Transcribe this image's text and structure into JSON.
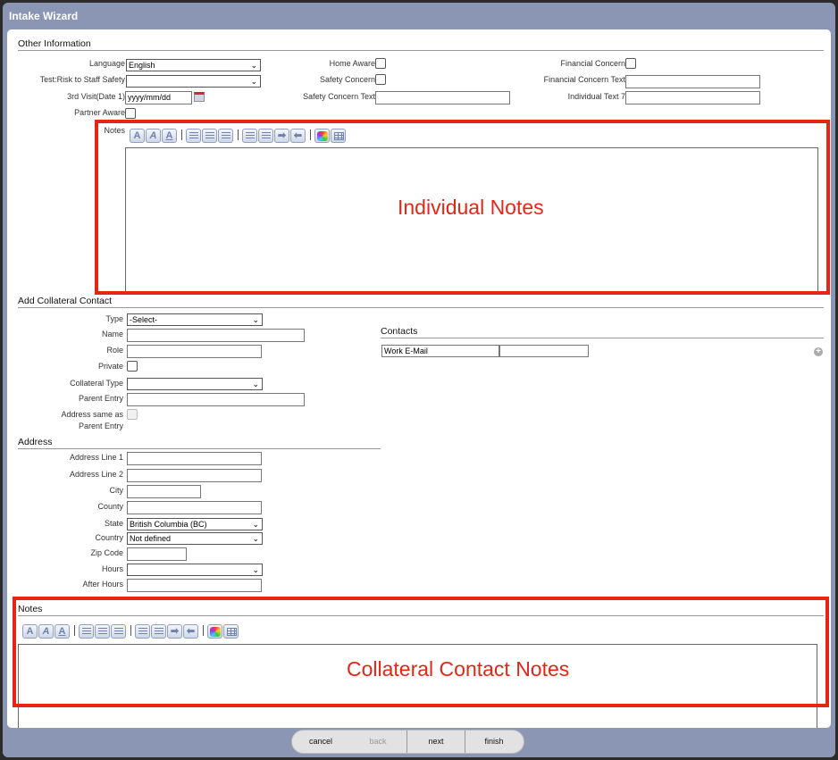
{
  "window": {
    "title": "Intake Wizard"
  },
  "other_info": {
    "heading": "Other Information",
    "language_label": "Language",
    "language_value": "English",
    "risk_label": "Test:Risk to Staff Safety",
    "risk_value": "",
    "third_visit_label": "3rd Visit(Date 1)",
    "third_visit_value": "yyyy/mm/dd",
    "partner_aware_label": "Partner Aware",
    "home_aware_label": "Home Aware",
    "safety_concern_label": "Safety Concern",
    "safety_concern_text_label": "Safety Concern Text",
    "financial_concern_label": "Financial Concern",
    "financial_concern_text_label": "Financial Concern Text",
    "individual_text7_label": "Individual Text 7",
    "notes_label": "Notes"
  },
  "annotations": {
    "individual_notes": "Individual Notes",
    "collateral_notes": "Collateral Contact Notes"
  },
  "collateral": {
    "heading": "Add Collateral Contact",
    "type_label": "Type",
    "type_value": "-Select-",
    "name_label": "Name",
    "role_label": "Role",
    "private_label": "Private",
    "collateral_type_label": "Collateral Type",
    "collateral_type_value": "",
    "parent_entry_label": "Parent Entry",
    "address_same_label_1": "Address same as",
    "address_same_label_2": "Parent Entry"
  },
  "contacts": {
    "heading": "Contacts",
    "type_value": "Work E-Mail",
    "value": ""
  },
  "address": {
    "heading": "Address",
    "line1_label": "Address Line 1",
    "line2_label": "Address Line 2",
    "city_label": "City",
    "county_label": "County",
    "state_label": "State",
    "state_value": "British Columbia (BC)",
    "country_label": "Country",
    "country_value": "Not defined",
    "zip_label": "Zip Code",
    "hours_label": "Hours",
    "hours_value": "",
    "after_hours_label": "After Hours"
  },
  "notes_section": {
    "heading": "Notes"
  },
  "toolbar": {
    "bold": "A",
    "italic": "A",
    "underline": "A"
  },
  "footer": {
    "cancel": "cancel",
    "back": "back",
    "next": "next",
    "finish": "finish"
  }
}
